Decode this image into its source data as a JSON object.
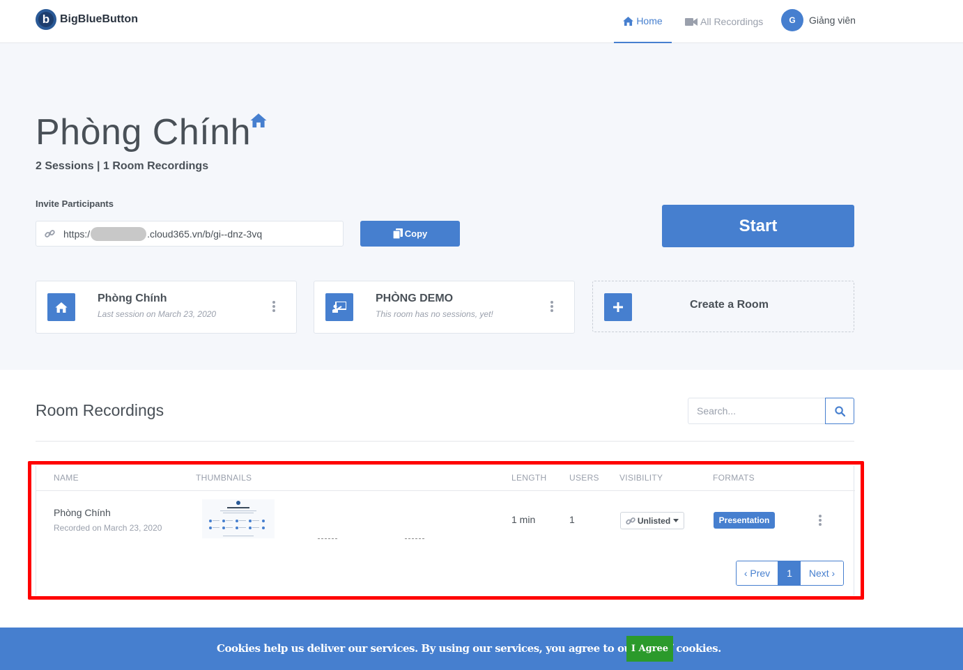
{
  "header": {
    "logo_text": "BigBlueButton",
    "logo_letter": "b",
    "nav_home": "Home",
    "nav_recordings": "All Recordings",
    "user_initial": "G",
    "user_name": "Giảng viên"
  },
  "room": {
    "title": "Phòng Chính",
    "stats": "2 Sessions | 1 Room Recordings",
    "invite_label": "Invite Participants",
    "invite_url_prefix": "https:/",
    "invite_url_suffix": ".cloud365.vn/b/gi--dnz-3vq",
    "copy_label": "Copy",
    "start_label": "Start"
  },
  "rooms": [
    {
      "name": "Phòng Chính",
      "subtitle": "Last session on March 23, 2020"
    },
    {
      "name": "PHÒNG DEMO",
      "subtitle": "This room has no sessions, yet!"
    }
  ],
  "create_room_label": "Create a Room",
  "recordings": {
    "title": "Room Recordings",
    "search_placeholder": "Search...",
    "columns": [
      "NAME",
      "THUMBNAILS",
      "LENGTH",
      "USERS",
      "VISIBILITY",
      "FORMATS"
    ],
    "rows": [
      {
        "name": "Phòng Chính",
        "recorded": "Recorded on March 23, 2020",
        "length": "1 min",
        "users": "1",
        "visibility": "Unlisted",
        "format": "Presentation",
        "thumbnail_heading": "Welcome To BigBlueButton"
      }
    ],
    "pagination": {
      "prev": "‹ Prev",
      "current": "1",
      "next": "Next ›"
    }
  },
  "cookie": {
    "text": "Cookies help us deliver our services. By using our services, you agree to our use of cookies.",
    "agree": "I Agree"
  },
  "colors": {
    "primary": "#467fcf",
    "agree": "#2b9a2b",
    "highlight": "#ff0000",
    "hero_bg": "#f5f7fb"
  }
}
